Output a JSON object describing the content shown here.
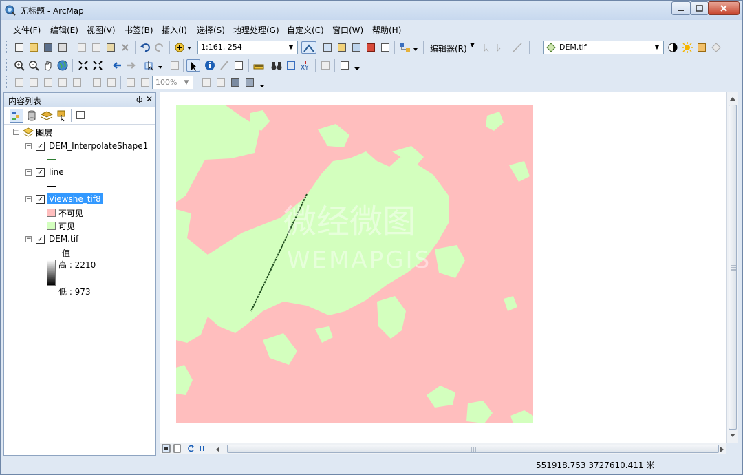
{
  "window": {
    "title": "无标题 - ArcMap",
    "min_label": "",
    "max_label": "",
    "close_label": ""
  },
  "menu": [
    "文件(F)",
    "编辑(E)",
    "视图(V)",
    "书签(B)",
    "插入(I)",
    "选择(S)",
    "地理处理(G)",
    "自定义(C)",
    "窗口(W)",
    "帮助(H)"
  ],
  "toolbar": {
    "scale_value": "1:161, 254",
    "editor_label": "编辑器(R)",
    "layer_combo_value": "DEM.tif",
    "zoom_value": "100%"
  },
  "toc": {
    "title": "内容列表",
    "pin": "ф",
    "close": "✕",
    "root_label": "图层",
    "layers": [
      {
        "name": "DEM_InterpolateShape1"
      },
      {
        "name": "line"
      },
      {
        "name": "Viewshe_tif8",
        "classes": [
          {
            "label": "不可见",
            "color": "#ffbebe"
          },
          {
            "label": "可见",
            "color": "#d3ffbe"
          }
        ]
      },
      {
        "name": "DEM.tif",
        "value_label": "值",
        "high_label": "高 : 2210",
        "low_label": "低 : 973"
      }
    ]
  },
  "map": {
    "watermark_cn": "微经微图",
    "watermark_en": "WEMAPGIS",
    "colors": {
      "invisible": "#ffbebe",
      "visible": "#d3ffbe",
      "line": "#1e4d1e"
    }
  },
  "status": {
    "coordinates": "551918.753  3727610.411 米"
  }
}
